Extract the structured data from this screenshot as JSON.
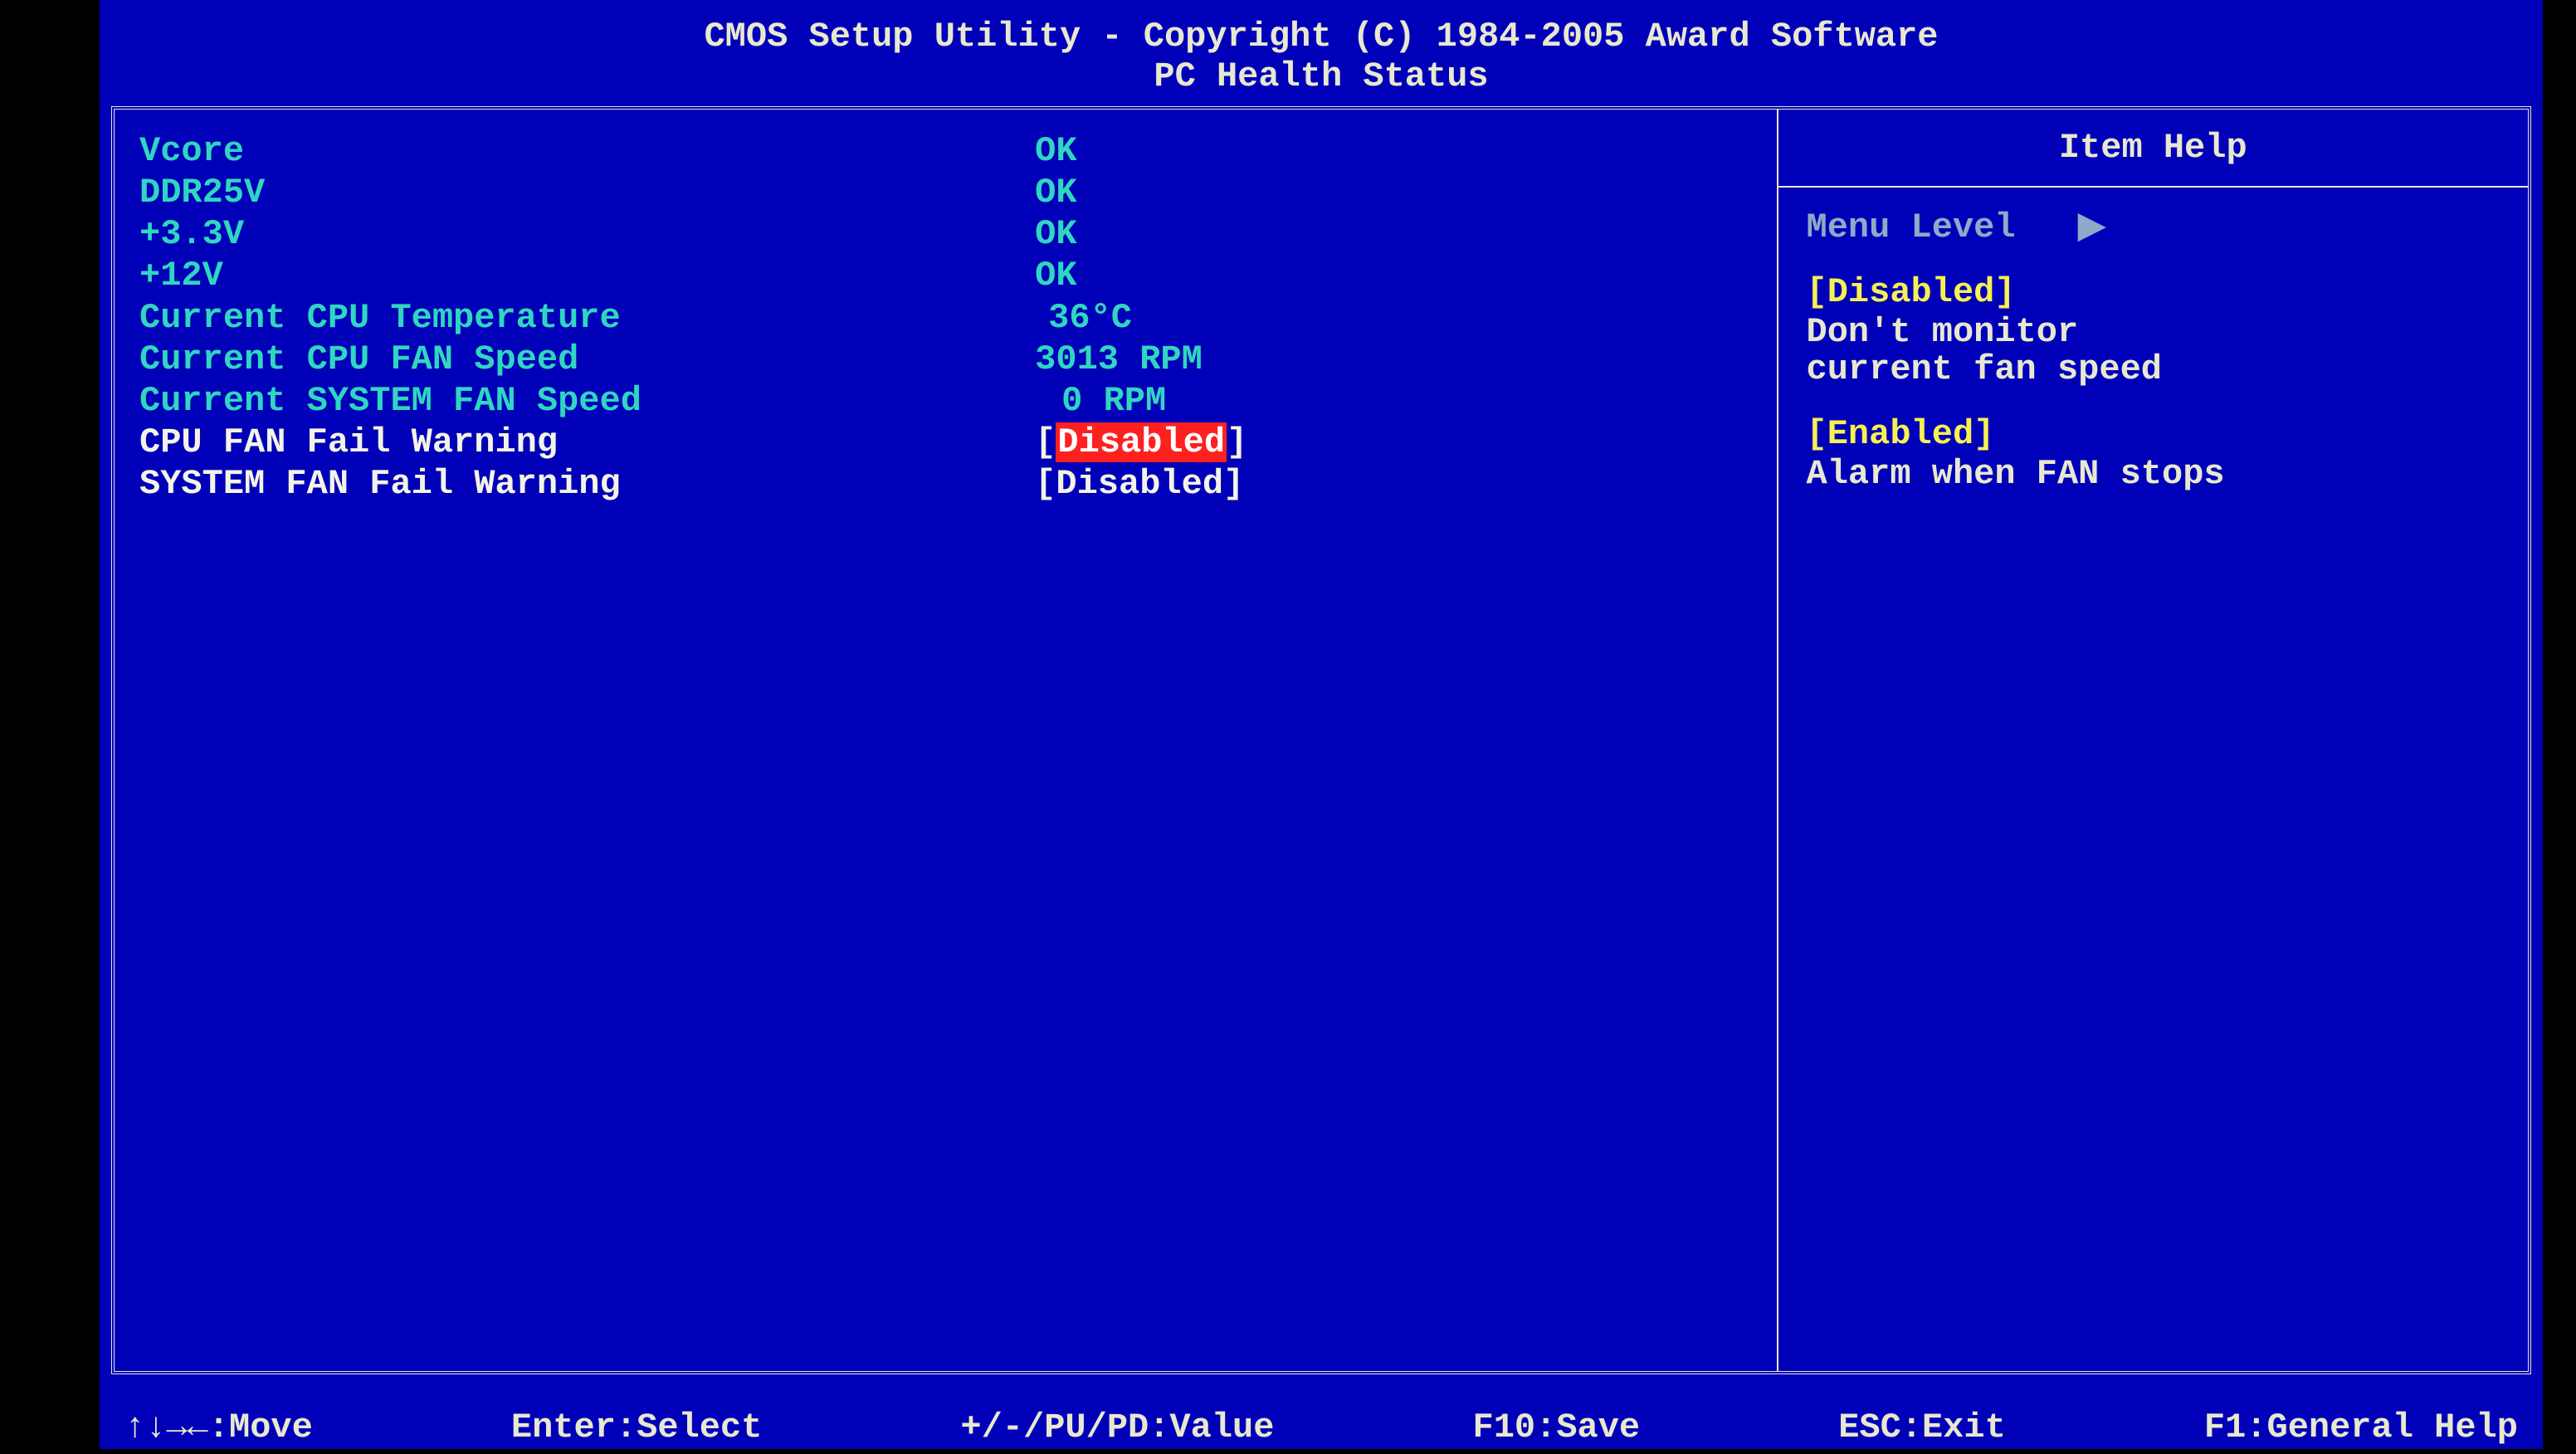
{
  "title": {
    "line1": "CMOS Setup Utility - Copyright (C) 1984-2005 Award Software",
    "line2": "PC Health Status"
  },
  "settings": {
    "vcore": {
      "label": "Vcore",
      "value": "OK"
    },
    "ddr25v": {
      "label": "DDR25V",
      "value": "OK"
    },
    "p33v": {
      "label": "+3.3V",
      "value": "OK"
    },
    "p12v": {
      "label": "+12V",
      "value": "OK"
    },
    "cpu_temp": {
      "label": "Current CPU Temperature",
      "value": "36°C"
    },
    "cpu_fan": {
      "label": "Current CPU FAN Speed",
      "value": "3013 RPM"
    },
    "sys_fan": {
      "label": "Current SYSTEM FAN Speed",
      "value": "0 RPM"
    },
    "cpu_warn": {
      "label": "CPU FAN Fail Warning",
      "value": "Disabled"
    },
    "sys_warn": {
      "label": "SYSTEM FAN Fail Warning",
      "value": "Disabled"
    }
  },
  "help": {
    "title": "Item Help",
    "menu_level": "Menu Level",
    "arrow": "▶",
    "opt1": "[Disabled]",
    "desc1a": "Don't monitor",
    "desc1b": "current fan speed",
    "opt2": "[Enabled]",
    "desc2": "Alarm when FAN stops"
  },
  "footer": {
    "move": "↑↓→←:Move",
    "select": "Enter:Select",
    "value": "+/-/PU/PD:Value",
    "save": "F10:Save",
    "exit": "ESC:Exit",
    "genhelp": "F1:General Help"
  }
}
